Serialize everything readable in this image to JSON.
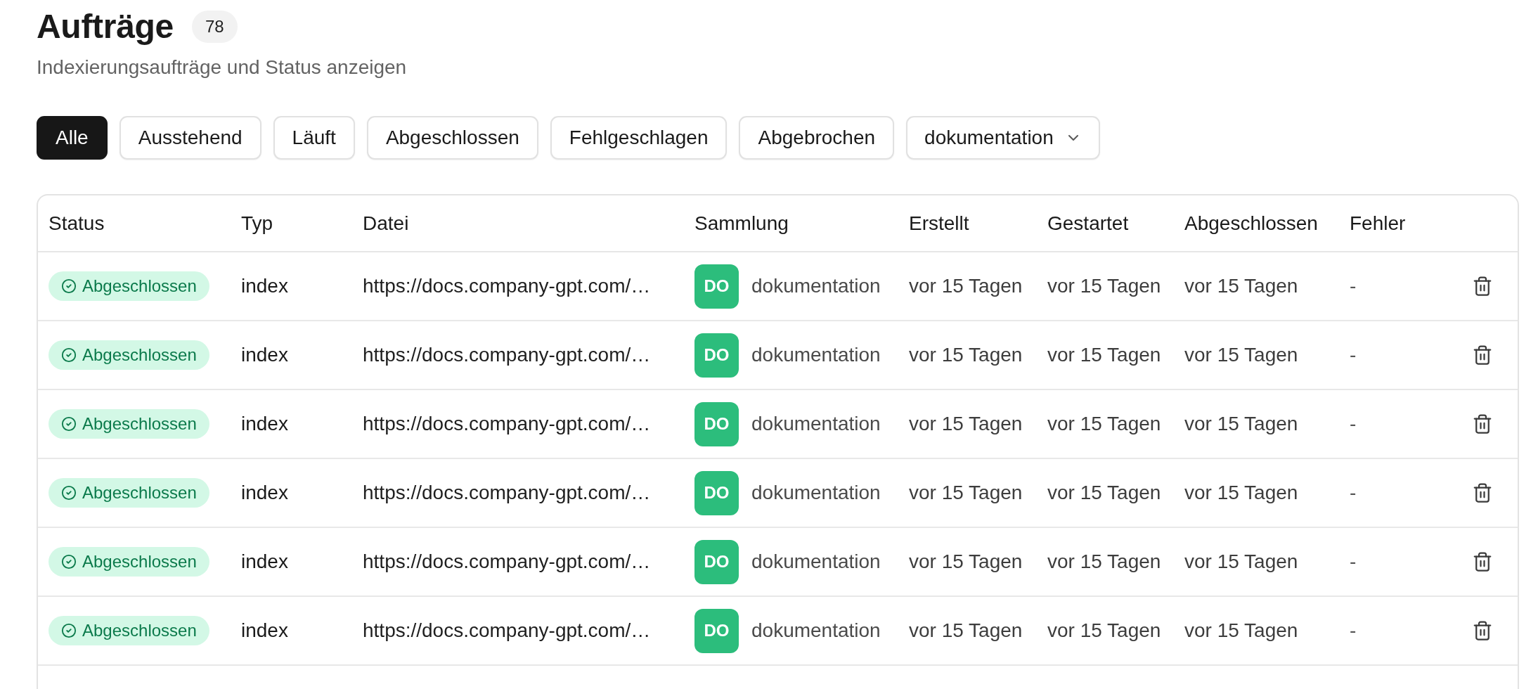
{
  "header": {
    "title": "Aufträge",
    "count": "78",
    "subtitle": "Indexierungsaufträge und Status anzeigen"
  },
  "filters": [
    {
      "label": "Alle",
      "selected": true
    },
    {
      "label": "Ausstehend",
      "selected": false
    },
    {
      "label": "Läuft",
      "selected": false
    },
    {
      "label": "Abgeschlossen",
      "selected": false
    },
    {
      "label": "Fehlgeschlagen",
      "selected": false
    },
    {
      "label": "Abgebrochen",
      "selected": false
    }
  ],
  "collection_filter": {
    "value": "dokumentation"
  },
  "table": {
    "columns": [
      "Status",
      "Typ",
      "Datei",
      "Sammlung",
      "Erstellt",
      "Gestartet",
      "Abgeschlossen",
      "Fehler"
    ],
    "rows": [
      {
        "status": {
          "kind": "completed",
          "label": "Abgeschlossen"
        },
        "type": "index",
        "file": "https://docs.company-gpt.com/…",
        "collection": {
          "initials": "DO",
          "name": "dokumentation"
        },
        "created": "vor 15 Tagen",
        "started": "vor 15 Tagen",
        "finished": "vor 15 Tagen",
        "error": "-"
      },
      {
        "status": {
          "kind": "completed",
          "label": "Abgeschlossen"
        },
        "type": "index",
        "file": "https://docs.company-gpt.com/…",
        "collection": {
          "initials": "DO",
          "name": "dokumentation"
        },
        "created": "vor 15 Tagen",
        "started": "vor 15 Tagen",
        "finished": "vor 15 Tagen",
        "error": "-"
      },
      {
        "status": {
          "kind": "completed",
          "label": "Abgeschlossen"
        },
        "type": "index",
        "file": "https://docs.company-gpt.com/…",
        "collection": {
          "initials": "DO",
          "name": "dokumentation"
        },
        "created": "vor 15 Tagen",
        "started": "vor 15 Tagen",
        "finished": "vor 15 Tagen",
        "error": "-"
      },
      {
        "status": {
          "kind": "completed",
          "label": "Abgeschlossen"
        },
        "type": "index",
        "file": "https://docs.company-gpt.com/…",
        "collection": {
          "initials": "DO",
          "name": "dokumentation"
        },
        "created": "vor 15 Tagen",
        "started": "vor 15 Tagen",
        "finished": "vor 15 Tagen",
        "error": "-"
      },
      {
        "status": {
          "kind": "completed",
          "label": "Abgeschlossen"
        },
        "type": "index",
        "file": "https://docs.company-gpt.com/…",
        "collection": {
          "initials": "DO",
          "name": "dokumentation"
        },
        "created": "vor 15 Tagen",
        "started": "vor 15 Tagen",
        "finished": "vor 15 Tagen",
        "error": "-"
      },
      {
        "status": {
          "kind": "completed",
          "label": "Abgeschlossen"
        },
        "type": "index",
        "file": "https://docs.company-gpt.com/…",
        "collection": {
          "initials": "DO",
          "name": "dokumentation"
        },
        "created": "vor 15 Tagen",
        "started": "vor 15 Tagen",
        "finished": "vor 15 Tagen",
        "error": "-"
      }
    ]
  }
}
